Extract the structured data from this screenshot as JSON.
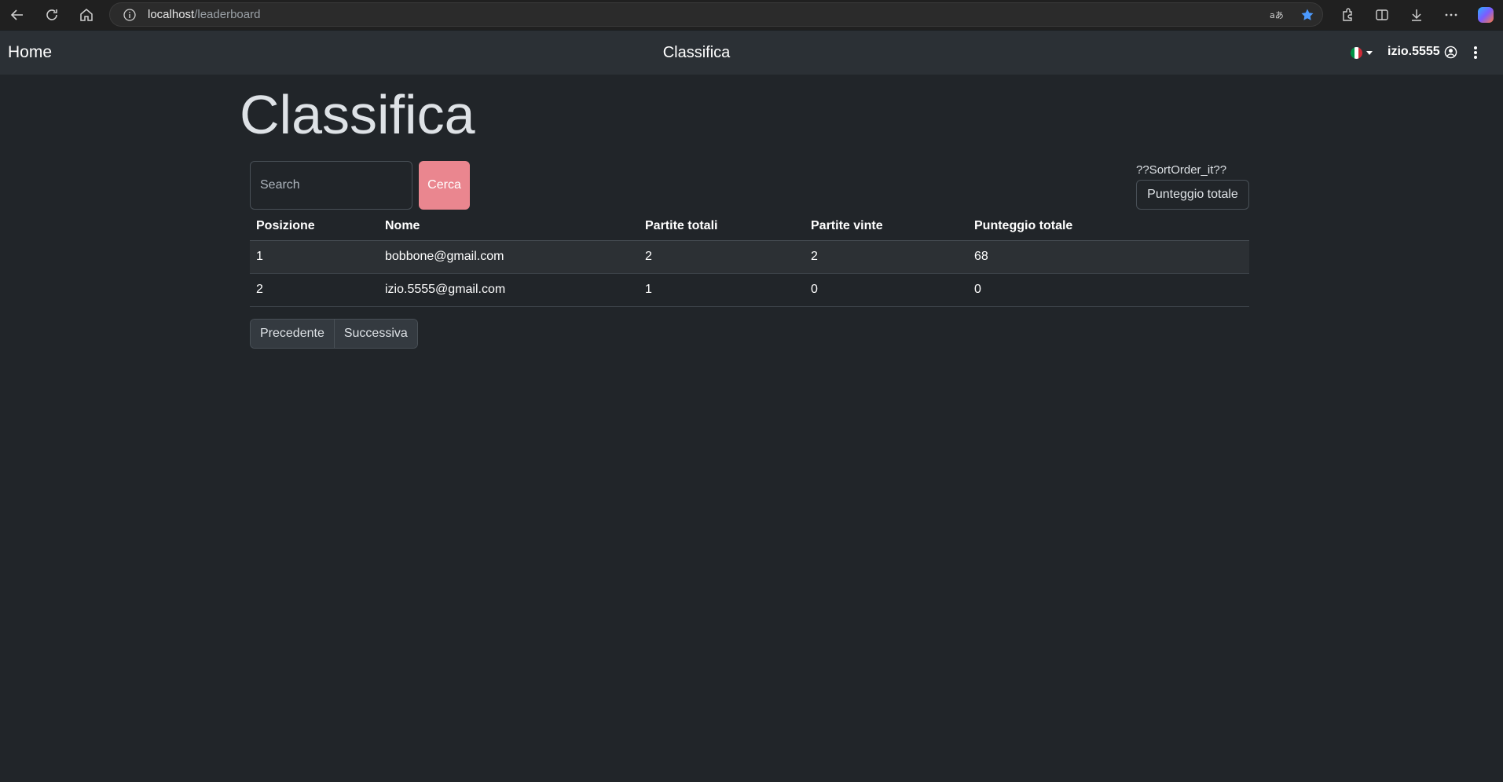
{
  "browser": {
    "url_host": "localhost",
    "url_path": "/leaderboard"
  },
  "navbar": {
    "brand": "Home",
    "title": "Classifica",
    "username": "izio.5555",
    "language_flag": "flag-italy-icon",
    "flag_colors": [
      "#009246",
      "#ffffff",
      "#ce2b37"
    ]
  },
  "page": {
    "title": "Classifica",
    "search_placeholder": "Search",
    "search_button": "Cerca",
    "sort_label": "??SortOrder_it??",
    "sort_value": "Punteggio totale"
  },
  "table": {
    "headers": [
      "Posizione",
      "Nome",
      "Partite totali",
      "Partite vinte",
      "Punteggio totale"
    ],
    "rows": [
      [
        "1",
        "bobbone@gmail.com",
        "2",
        "2",
        "68"
      ],
      [
        "2",
        "izio.5555@gmail.com",
        "1",
        "0",
        "0"
      ]
    ]
  },
  "pagination": {
    "prev": "Precedente",
    "next": "Successiva"
  },
  "colors": {
    "background": "#212529",
    "navbar": "#2b3035",
    "search_button": "#ea868f"
  }
}
